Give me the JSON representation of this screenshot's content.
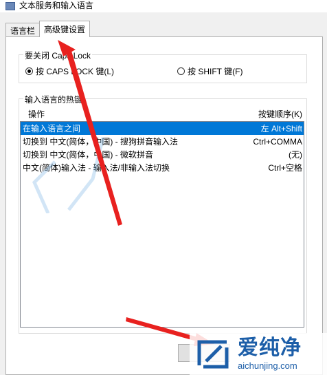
{
  "window": {
    "title": "文本服务和输入语言"
  },
  "tabs": [
    {
      "label": "语言栏"
    },
    {
      "label": "高级键设置"
    }
  ],
  "caps_group": {
    "title": "要关闭 Caps Lock",
    "options": [
      {
        "label": "按 CAPS LOCK 键(L)",
        "checked": true
      },
      {
        "label": "按 SHIFT 键(F)",
        "checked": false
      }
    ]
  },
  "hotkey_group": {
    "title": "输入语言的热键",
    "col_action": "操作",
    "col_keys": "按键顺序(K)",
    "rows": [
      {
        "action": "在输入语言之间",
        "keys": "左 Alt+Shift",
        "selected": true
      },
      {
        "action": "切换到 中文(简体，中国) - 搜狗拼音输入法",
        "keys": "Ctrl+COMMA",
        "selected": false
      },
      {
        "action": "切换到 中文(简体，中国) - 微软拼音",
        "keys": "(无)",
        "selected": false
      },
      {
        "action": "中文(简体)输入法 - 输入法/非输入法切换",
        "keys": "Ctrl+空格",
        "selected": false
      }
    ]
  },
  "watermark": {
    "brand_cn": "爱纯净",
    "brand_url": "aichunjing.com"
  },
  "colors": {
    "selection": "#0078d7",
    "annotation": "#e8211f",
    "brand": "#1c5ea8"
  }
}
